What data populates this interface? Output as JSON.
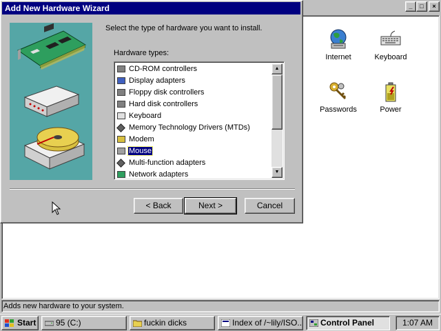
{
  "control_panel": {
    "caption_buttons": {
      "minimize": "_",
      "maximize": "□",
      "close": "×"
    },
    "icons": [
      {
        "id": "internet",
        "label": "Internet",
        "icon": "globe-icon"
      },
      {
        "id": "keyboard",
        "label": "Keyboard",
        "icon": "keyboard-icon"
      },
      {
        "id": "passwords",
        "label": "Passwords",
        "icon": "keys-icon"
      },
      {
        "id": "power",
        "label": "Power",
        "icon": "battery-icon"
      }
    ],
    "status_text": "Adds new hardware to your system."
  },
  "wizard": {
    "title": "Add New Hardware Wizard",
    "instruction": "Select the type of hardware you want to install.",
    "list_label": "Hardware types:",
    "hardware_types": [
      {
        "label": "CD-ROM controllers",
        "icon": "cdrom-controller-icon",
        "selected": false
      },
      {
        "label": "Display adapters",
        "icon": "monitor-icon",
        "selected": false
      },
      {
        "label": "Floppy disk controllers",
        "icon": "floppy-controller-icon",
        "selected": false
      },
      {
        "label": "Hard disk controllers",
        "icon": "hard-disk-controller-icon",
        "selected": false
      },
      {
        "label": "Keyboard",
        "icon": "keyboard-icon",
        "selected": false
      },
      {
        "label": "Memory Technology Drivers (MTDs)",
        "icon": "diamond-icon",
        "selected": false
      },
      {
        "label": "Modem",
        "icon": "modem-icon",
        "selected": false
      },
      {
        "label": "Mouse",
        "icon": "mouse-icon",
        "selected": true
      },
      {
        "label": "Multi-function adapters",
        "icon": "diamond-icon",
        "selected": false
      },
      {
        "label": "Network adapters",
        "icon": "network-adapter-icon",
        "selected": false
      }
    ],
    "buttons": {
      "back": "< Back",
      "next": "Next >",
      "cancel": "Cancel"
    }
  },
  "taskbar": {
    "start_label": "Start",
    "tasks": [
      {
        "label": "95 (C:)",
        "icon": "drive-icon",
        "active": false
      },
      {
        "label": "fuckin dicks",
        "icon": "folder-icon",
        "active": false
      },
      {
        "label": "Index of /~lily/ISO...",
        "icon": "browser-icon",
        "active": false
      },
      {
        "label": "Control Panel",
        "icon": "control-panel-icon",
        "active": true
      }
    ],
    "clock": "1:07 AM"
  },
  "colors": {
    "titlebar": "#000080",
    "face": "#c0c0c0",
    "art_background": "#55a6a6",
    "selection": "#000080"
  }
}
